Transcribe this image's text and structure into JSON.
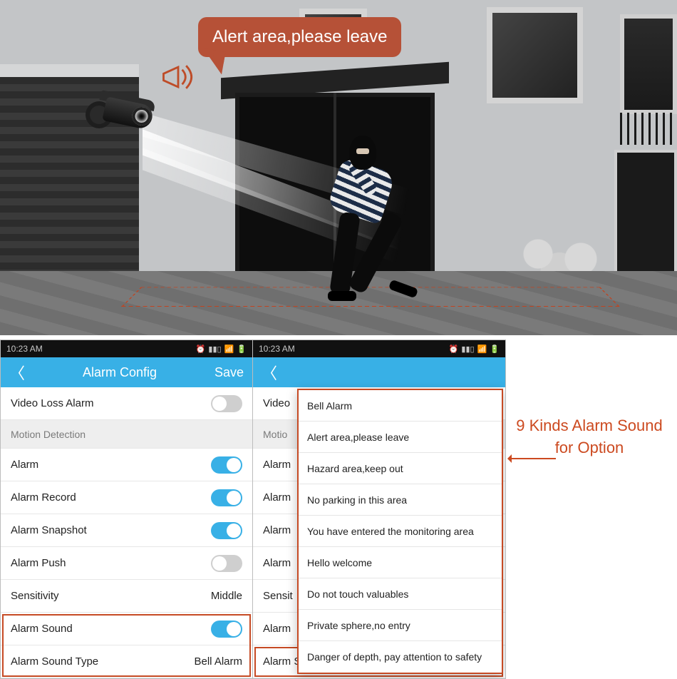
{
  "scene": {
    "speech_text": "Alert area,please leave"
  },
  "statusbar": {
    "time": "10:23 AM",
    "alarm_icon": "⏰",
    "signal_icon": "▮▮▯",
    "wifi_icon": "📶",
    "battery_icon": "🔋"
  },
  "navbar": {
    "back": "〈",
    "title": "Alarm Config",
    "save": "Save"
  },
  "rows": {
    "video_loss": "Video Loss Alarm",
    "section_motion": "Motion Detection",
    "alarm": "Alarm",
    "alarm_record": "Alarm Record",
    "alarm_snapshot": "Alarm Snapshot",
    "alarm_push": "Alarm Push",
    "sensitivity_label": "Sensitivity",
    "sensitivity_value": "Middle",
    "alarm_sound": "Alarm Sound",
    "alarm_sound_type_label": "Alarm Sound Type",
    "alarm_sound_type_value": "Bell Alarm"
  },
  "phone2_partial": {
    "video": "Video",
    "motio": "Motio",
    "alarm": "Alarm",
    "sensit": "Sensit"
  },
  "dropdown_options": [
    "Bell Alarm",
    "Alert area,please leave",
    "Hazard area,keep out",
    "No parking in this area",
    "You have entered the monitoring area",
    "Hello welcome",
    "Do not touch valuables",
    "Private sphere,no entry",
    "Danger of depth, pay attention to safety"
  ],
  "annotation": {
    "line1": "9 Kinds Alarm Sound",
    "line2": "for Option"
  }
}
